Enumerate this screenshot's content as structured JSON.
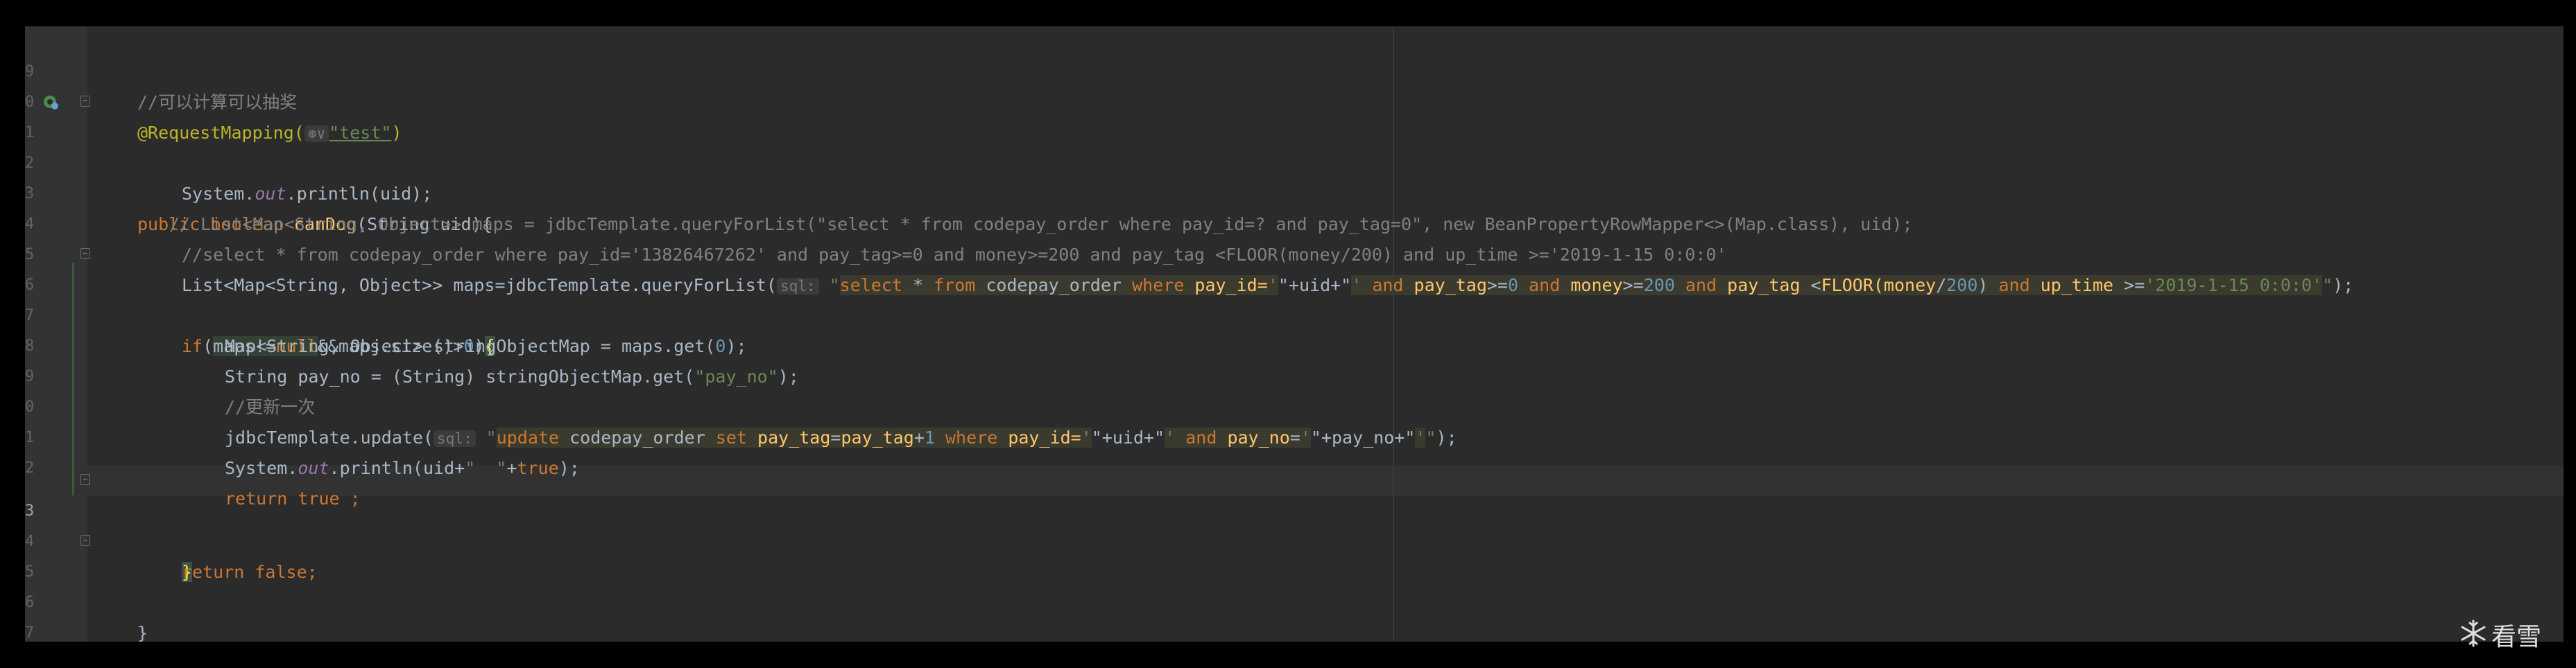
{
  "editor": {
    "line_numbers": [
      "9",
      "0",
      "1",
      "2",
      "3",
      "4",
      "5",
      "6",
      "7",
      "8",
      "9",
      "0",
      "1",
      "2",
      "3",
      "4",
      "5",
      "6",
      "7"
    ],
    "lines": {
      "l0": {
        "comment": "//可以计算可以抽奖"
      },
      "l1": {
        "ann": "@RequestMapping(",
        "hint": "⊛∨",
        "str": "\"test\"",
        "end": ")"
      },
      "l2": {
        "kw": "public boolean ",
        "fn": "canDog",
        "rest": "(String uid){"
      },
      "l3": {
        "a": "System.",
        "fld": "out",
        "b": ".println(uid);"
      },
      "l4": {
        "comment": "// List<Map<String, Object>> maps = jdbcTemplate.queryForList(\"select * from codepay_order where pay_id=? and pay_tag=0\", new BeanPropertyRowMapper<>(Map.class), uid);"
      },
      "l5": {
        "comment": "//select * from codepay_order where pay_id='13826467262' and pay_tag>=0 and money>=200 and pay_tag <FLOOR(money/200) and up_time >='2019-1-15 0:0:0'"
      },
      "l6": {
        "a": "List<Map<String, Object>> maps=jdbcTemplate.queryForList(",
        "hint": "sql:",
        "q1": "\"",
        "s_select": "select",
        "s_star": " * ",
        "s_from": "from",
        "s_table": " codepay_order ",
        "s_where": "where",
        "s_payid": " pay_id=",
        "s_q": "'",
        "s_concat1": "\"+uid+\"",
        "s_q2": "'",
        "s_and1": " and ",
        "s_paytag": "pay_tag",
        "s_ge0": ">=",
        "s_zero": "0",
        "s_and2": " and ",
        "s_money": "money",
        "s_ge200": ">=",
        "s_200": "200",
        "s_and3": " and ",
        "s_paytag2": "pay_tag",
        "s_lt": " <",
        "s_floor": "FLOOR(",
        "s_money2": "money",
        "s_div": "/",
        "s_200b": "200",
        "s_close": ") ",
        "s_and4": "and ",
        "s_uptime": "up_time",
        "s_gte": " >=",
        "s_date": "'2019-1-15 0:0:0'",
        "q2": "\"",
        "end": ");"
      },
      "l7": {
        "kw": "if",
        "p1": "(",
        "maps": "maps",
        "neq": "!=",
        "null": "null",
        "rest": "&&maps.size()>",
        "zero": "0",
        "p2": ")",
        "brace": "{"
      },
      "l8": {
        "a": "Map<String, Object> stringObjectMap = maps.get(",
        "num": "0",
        "b": ");"
      },
      "l9": {
        "a": "String pay_no = (String) stringObjectMap.get(",
        "str": "\"pay_no\"",
        "b": ");"
      },
      "l10": {
        "comment": "//更新一次"
      },
      "l11": {
        "a": "jdbcTemplate.update(",
        "hint": "sql:",
        "q1": "\"",
        "s_update": "update",
        "s_table": " codepay_order ",
        "s_set": "set",
        "s_paytag": " pay_tag",
        "s_eq": "=",
        "s_paytag2": "pay_tag",
        "s_plus": "+",
        "s_one": "1",
        "s_where": " where",
        "s_payid": " pay_id=",
        "s_q": "'",
        "s_concat1": "\"+uid+\"",
        "s_q2": "'",
        "s_and": " and ",
        "s_payno": "pay_no",
        "s_eq2": "=",
        "s_q3": "'",
        "s_concat2": "\"+pay_no+\"",
        "s_q4": "'",
        "q2": "\"",
        "end": ");"
      },
      "l12": {
        "a": "System.",
        "fld": "out",
        "b": ".println(uid+",
        "str": "\"  \"",
        "c": "+",
        "kw": "true",
        "d": ");"
      },
      "l13": {
        "kw": "return true",
        "b": " ;"
      },
      "l14": {
        "brace": "}"
      },
      "l15": {
        "kw": "return false",
        "b": ";"
      },
      "l16": {
        "brace": "}"
      }
    }
  },
  "watermark": {
    "text": "看雪",
    "icon": "snowflake-icon"
  }
}
